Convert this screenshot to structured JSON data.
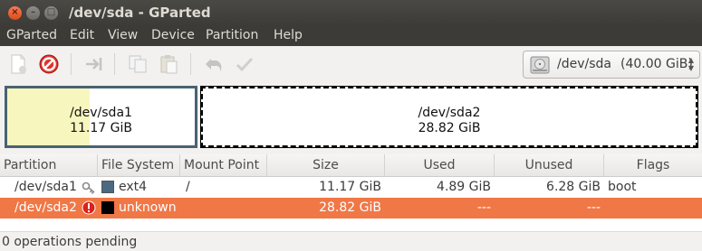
{
  "window": {
    "title": "/dev/sda - GParted"
  },
  "menu": [
    "GParted",
    "Edit",
    "View",
    "Device",
    "Partition",
    "Help"
  ],
  "toolbar": {
    "icons": [
      "new-partition-icon",
      "delete-icon",
      "resize-move-icon",
      "copy-icon",
      "paste-icon",
      "undo-icon",
      "apply-icon"
    ],
    "device": "/dev/sda",
    "device_size": "(40.00 GiB)"
  },
  "diskmap": {
    "partitions": [
      {
        "name": "/dev/sda1",
        "size": "11.17 GiB",
        "used_fraction": 0.44,
        "fill_color": "#f7f6be",
        "border_color": "#496272"
      },
      {
        "name": "/dev/sda2",
        "size": "28.82 GiB",
        "used_fraction": 0
      }
    ]
  },
  "table": {
    "headers": [
      "Partition",
      "File System",
      "Mount Point",
      "Size",
      "Used",
      "Unused",
      "Flags"
    ],
    "rows": [
      {
        "partition": "/dev/sda1",
        "icon": "key-icon",
        "fs_color": "#4b6983",
        "filesystem": "ext4",
        "mount": "/",
        "size": "11.17 GiB",
        "used": "4.89 GiB",
        "unused": "6.28 GiB",
        "flags": "boot",
        "selected": false
      },
      {
        "partition": "/dev/sda2",
        "icon": "error-icon",
        "fs_color": "#000000",
        "filesystem": "unknown",
        "mount": "",
        "size": "28.82 GiB",
        "used": "---",
        "unused": "---",
        "flags": "",
        "selected": true
      }
    ]
  },
  "status": {
    "text": "0 operations pending"
  },
  "colors": {
    "selection": "#f07746",
    "titlebar": "#3c3b37"
  }
}
